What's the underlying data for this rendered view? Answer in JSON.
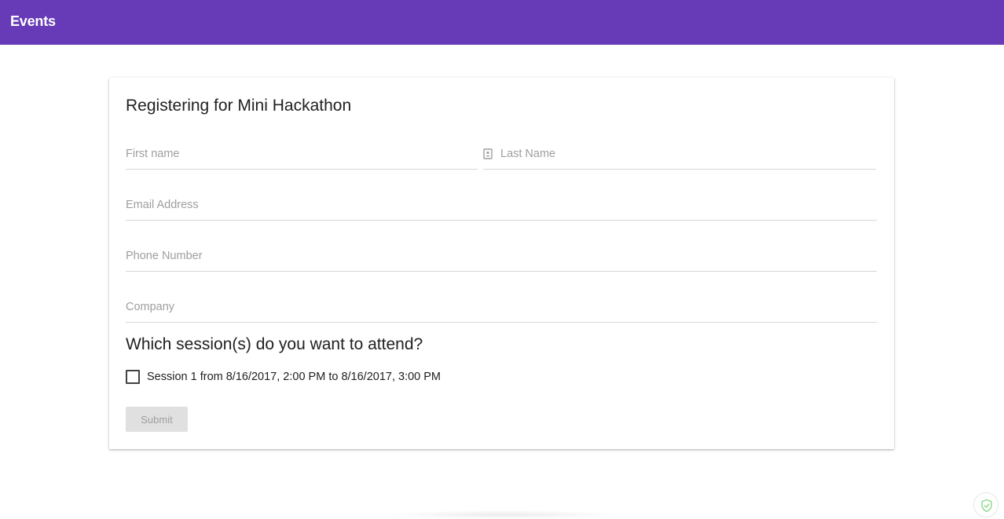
{
  "app": {
    "title": "Events"
  },
  "form": {
    "title": "Registering for Mini Hackathon",
    "fields": {
      "first_name": {
        "placeholder": "First name",
        "value": ""
      },
      "last_name": {
        "placeholder": "Last Name",
        "value": "",
        "icon": "contact-card-icon"
      },
      "email": {
        "placeholder": "Email Address",
        "value": ""
      },
      "phone": {
        "placeholder": "Phone Number",
        "value": ""
      },
      "company": {
        "placeholder": "Company",
        "value": ""
      }
    },
    "sessions_heading": "Which session(s) do you want to attend?",
    "sessions": [
      {
        "label": "Session 1 from 8/16/2017, 2:00 PM to 8/16/2017, 3:00 PM",
        "checked": false
      }
    ],
    "submit_label": "Submit",
    "submit_disabled": true
  },
  "icons": {
    "shield": "shield-check-icon"
  },
  "colors": {
    "app_bar": "#673ab7",
    "app_bar_text": "#ffffff",
    "submit_bg_disabled": "#e0e0e0",
    "submit_text_disabled": "#9e9e9e",
    "shield_accent": "#8bd98b"
  }
}
